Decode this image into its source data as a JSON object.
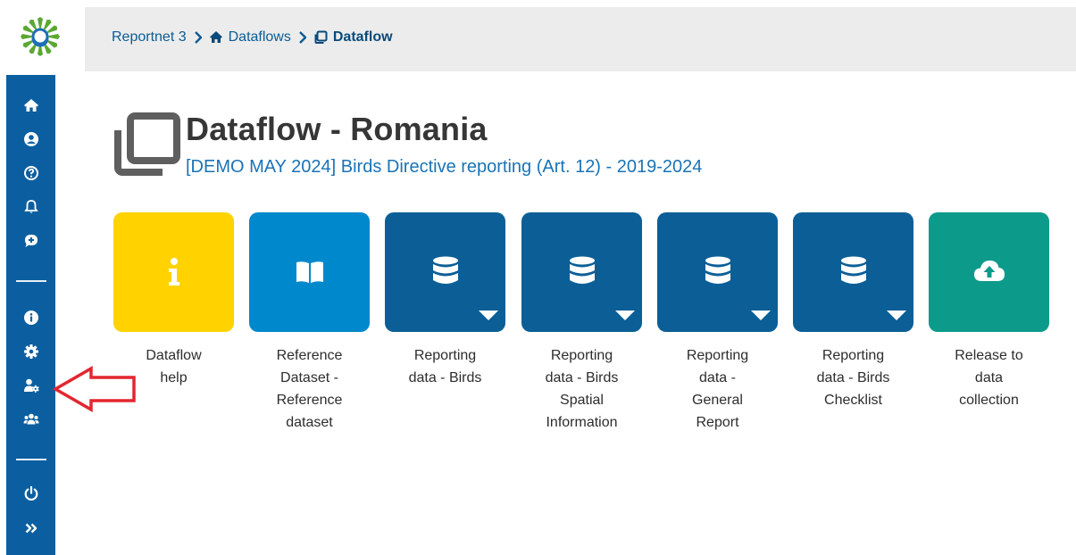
{
  "colors": {
    "sidebar": "#0b5fa0",
    "header": "#ececec",
    "link": "#1a73b6",
    "tile_help": "#ffd200",
    "tile_reference": "#0088cc",
    "tile_reporting": "#0b5f96",
    "tile_release": "#0c9b8a",
    "annotation_arrow": "#e3262e"
  },
  "breadcrumb": {
    "root": "Reportnet 3",
    "dataflows": "Dataflows",
    "current": "Dataflow"
  },
  "sidebar": {
    "items": [
      {
        "name": "home",
        "icon": "home-icon"
      },
      {
        "name": "user-profile",
        "icon": "user-circle-icon"
      },
      {
        "name": "help",
        "icon": "question-circle-icon"
      },
      {
        "name": "notifications",
        "icon": "bell-icon"
      },
      {
        "name": "feedback",
        "icon": "comment-plus-icon"
      },
      {
        "name": "info",
        "icon": "info-circle-icon"
      },
      {
        "name": "settings",
        "icon": "gear-icon"
      },
      {
        "name": "manage-users",
        "icon": "user-gear-icon"
      },
      {
        "name": "team",
        "icon": "users-icon"
      },
      {
        "name": "logout",
        "icon": "power-icon"
      },
      {
        "name": "expand",
        "icon": "double-chevron-right-icon"
      }
    ]
  },
  "page": {
    "title": "Dataflow - Romania",
    "subtitle": "[DEMO MAY 2024] Birds Directive reporting (Art. 12) - 2019-2024"
  },
  "tiles": [
    {
      "label": "Dataflow help",
      "lines": [
        "Dataflow",
        "help"
      ],
      "icon": "info-icon",
      "dropdown": false
    },
    {
      "label": "Reference Dataset - Reference dataset",
      "lines": [
        "Reference",
        "Dataset -",
        "Reference",
        "dataset"
      ],
      "icon": "book-open-icon",
      "dropdown": false
    },
    {
      "label": "Reporting data - Birds",
      "lines": [
        "Reporting",
        "data - Birds"
      ],
      "icon": "database-icon",
      "dropdown": true
    },
    {
      "label": "Reporting data - Birds Spatial Information",
      "lines": [
        "Reporting",
        "data - Birds",
        "Spatial",
        "Information"
      ],
      "icon": "database-icon",
      "dropdown": true
    },
    {
      "label": "Reporting data - General Report",
      "lines": [
        "Reporting",
        "data -",
        "General",
        "Report"
      ],
      "icon": "database-icon",
      "dropdown": true
    },
    {
      "label": "Reporting data - Birds Checklist",
      "lines": [
        "Reporting",
        "data - Birds",
        "Checklist"
      ],
      "icon": "database-icon",
      "dropdown": true
    },
    {
      "label": "Release to data collection",
      "lines": [
        "Release to",
        "data",
        "collection"
      ],
      "icon": "cloud-upload-icon",
      "dropdown": false
    }
  ]
}
